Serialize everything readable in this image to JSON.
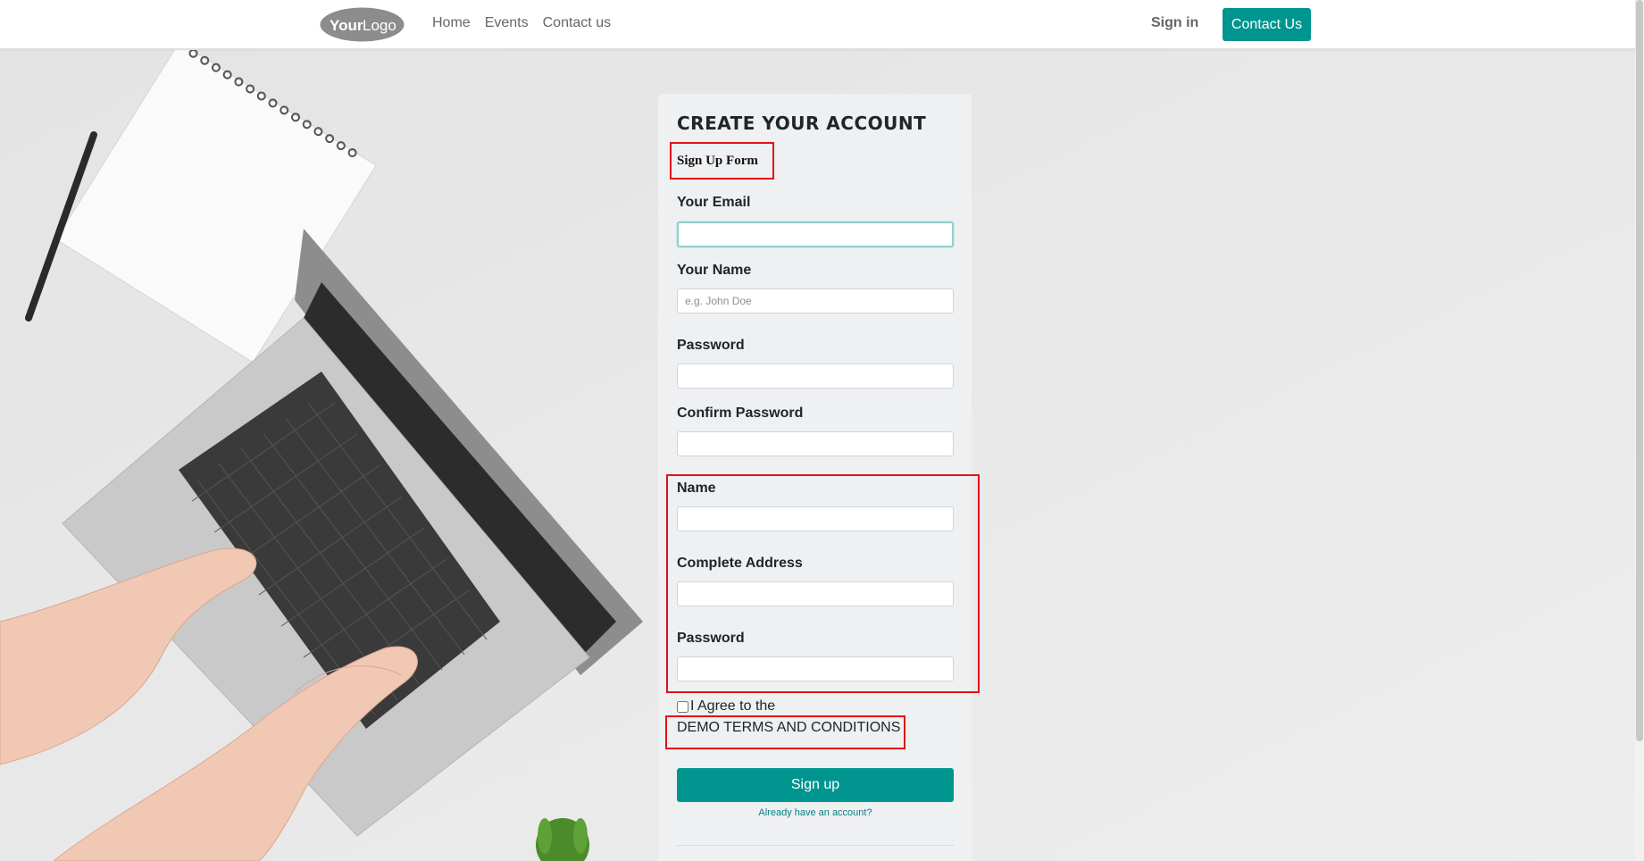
{
  "colors": {
    "accent": "#00958f",
    "highlight_box": "#e0121a",
    "focus_ring": "#8fd1cc"
  },
  "header": {
    "logo_text_bold": "Your",
    "logo_text_light": "Logo",
    "nav": [
      {
        "label": "Home"
      },
      {
        "label": "Events"
      },
      {
        "label": "Contact us"
      }
    ],
    "sign_in_label": "Sign in",
    "contact_button_label": "Contact Us"
  },
  "form": {
    "title": "CREATE YOUR ACCOUNT",
    "subtitle": "Sign Up Form",
    "fields": {
      "email": {
        "label": "Your Email",
        "value": "",
        "placeholder": ""
      },
      "name": {
        "label": "Your Name",
        "value": "",
        "placeholder": "e.g. John Doe"
      },
      "password": {
        "label": "Password",
        "value": "",
        "placeholder": ""
      },
      "confirm_password": {
        "label": "Confirm Password",
        "value": "",
        "placeholder": ""
      },
      "extra_name": {
        "label": "Name",
        "value": "",
        "placeholder": ""
      },
      "complete_address": {
        "label": "Complete Address",
        "value": "",
        "placeholder": ""
      },
      "extra_password": {
        "label": "Password",
        "value": "",
        "placeholder": ""
      }
    },
    "agree_label": "I Agree to the",
    "terms_label": "DEMO TERMS AND CONDITIONS",
    "signup_button_label": "Sign up",
    "already_account_label": "Already have an account?"
  }
}
